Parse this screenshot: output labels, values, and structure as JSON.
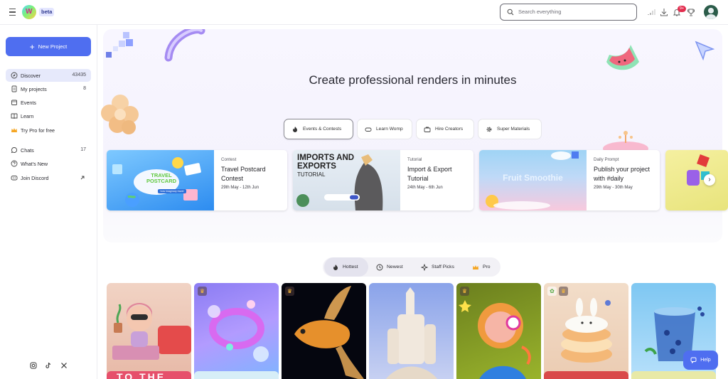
{
  "app": {
    "beta_label": "beta"
  },
  "search": {
    "placeholder": "Search everything"
  },
  "notifications": {
    "badge": "9+"
  },
  "sidebar": {
    "new_project": "New Project",
    "items": [
      {
        "label": "Discover",
        "count": "43435"
      },
      {
        "label": "My projects",
        "count": "8"
      },
      {
        "label": "Events",
        "count": ""
      },
      {
        "label": "Learn",
        "count": ""
      },
      {
        "label": "Try Pro for free",
        "count": ""
      },
      {
        "label": "Chats",
        "count": "17"
      },
      {
        "label": "What's New",
        "count": ""
      },
      {
        "label": "Join Discord",
        "count": ""
      }
    ],
    "social": [
      "instagram-icon",
      "tiktok-icon",
      "x-icon"
    ]
  },
  "hero": {
    "title": "Create professional renders in minutes"
  },
  "categories": [
    "Events & Contests",
    "Learn Womp",
    "Hire Creators",
    "Super Materials"
  ],
  "cards": [
    {
      "type": "Contest",
      "title": "Travel Postcard Contest",
      "dates": "29th May - 12th Jun",
      "thumb_text": "TRAVEL POSTCARD",
      "thumb_sub": "how imaginary travel"
    },
    {
      "type": "Tutorial",
      "title": "Import & Export Tutorial",
      "dates": "24th May - 6th Jun",
      "thumb_text": "IMPORTS AND EXPORTS",
      "thumb_sub": "TUTORIAL"
    },
    {
      "type": "Daily Prompt",
      "title": "Publish your project with #daily",
      "dates": "29th May - 30th May",
      "thumb_text": "Fruit Smoothie",
      "thumb_sub": ""
    }
  ],
  "filters": [
    "Hottest",
    "Newest",
    "Staff Picks",
    "Pro"
  ],
  "strip_text": "TO THE",
  "help": {
    "label": "Help"
  },
  "colors": {
    "accent": "#4f6ef0",
    "notification": "#e22e4f",
    "pro": "#ffbe3a"
  }
}
